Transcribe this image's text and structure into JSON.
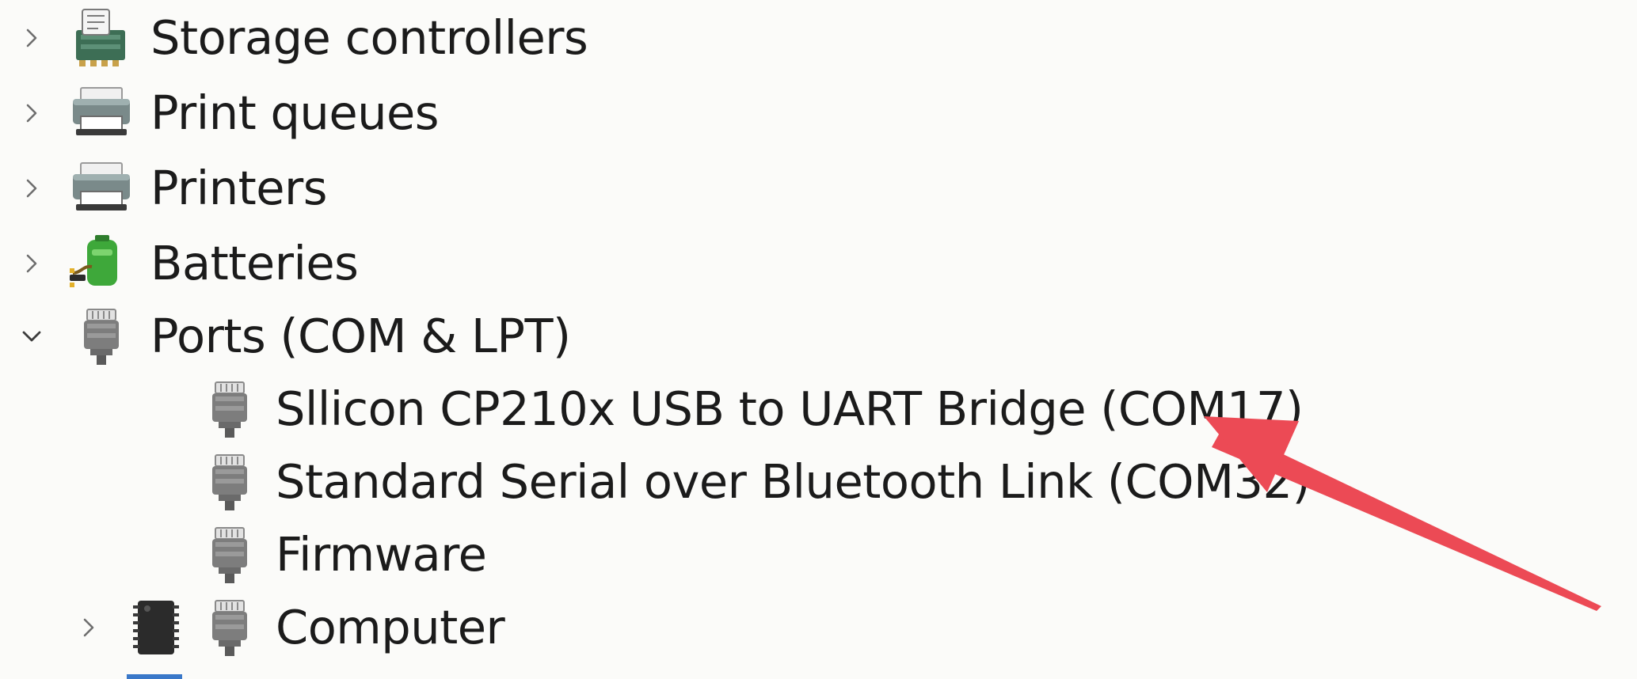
{
  "tree": {
    "categories": [
      {
        "label": "Storage controllers",
        "expanded": false,
        "icon": "storage-controller-icon"
      },
      {
        "label": "Print queues",
        "expanded": false,
        "icon": "printer-icon"
      },
      {
        "label": "Printers",
        "expanded": false,
        "icon": "printer-icon"
      },
      {
        "label": "Batteries",
        "expanded": false,
        "icon": "battery-icon"
      },
      {
        "label": "Ports (COM & LPT)",
        "expanded": true,
        "icon": "port-connector-icon"
      }
    ],
    "ports_children": [
      {
        "label": "Sllicon CP210x USB to UART Bridge (COM17)",
        "icon": "port-connector-icon"
      },
      {
        "label": "Standard Serial over Bluetooth Link (COM32)",
        "icon": "port-connector-icon"
      },
      {
        "label": "Firmware",
        "icon": "port-connector-icon"
      },
      {
        "label": "Computer",
        "icon": "port-connector-icon",
        "extra_icon": "chip-icon",
        "expanded": false
      }
    ]
  },
  "annotation": {
    "arrow_color": "#ec4a55",
    "points_to": "Sllicon CP210x USB to UART Bridge (COM17)"
  },
  "colors": {
    "background": "#fbfbf9",
    "text": "#1b1b1b",
    "chevron": "#6e6e6e",
    "battery_green": "#3ea83a",
    "connector_gray": "#7d7d7d"
  }
}
